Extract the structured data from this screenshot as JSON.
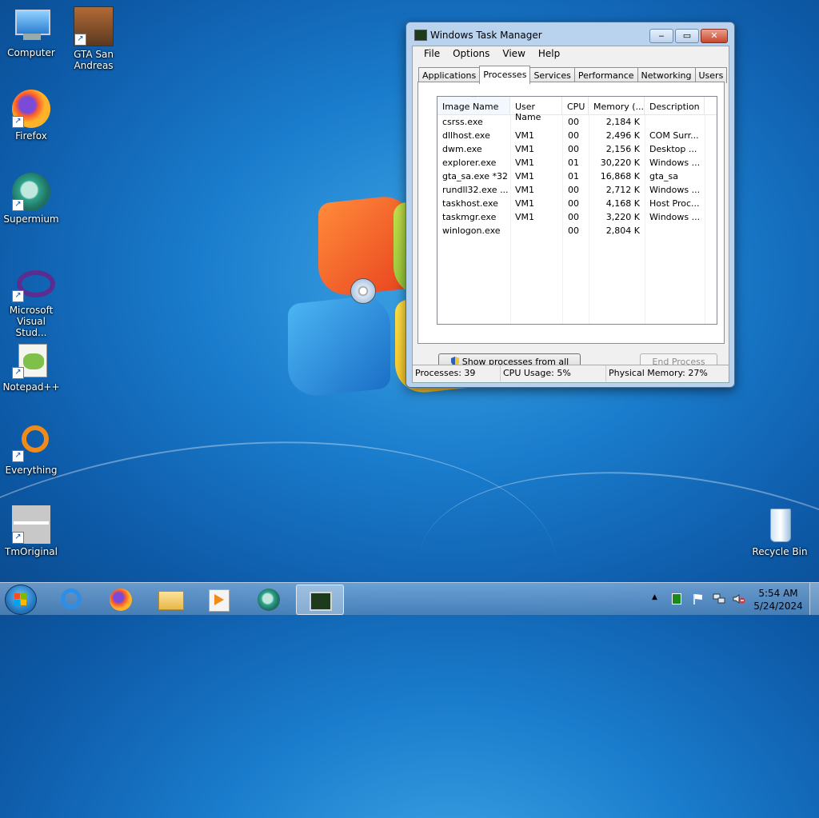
{
  "desktop": {
    "icons": [
      {
        "label_line1": "Computer",
        "label_line2": "",
        "icon": "computer-icon"
      },
      {
        "label_line1": "GTA San",
        "label_line2": "Andreas",
        "icon": "gta-icon"
      },
      {
        "label_line1": "Firefox",
        "label_line2": "",
        "icon": "firefox-icon"
      },
      {
        "label_line1": "Supermium",
        "label_line2": "",
        "icon": "supermium-icon"
      },
      {
        "label_line1": "Microsoft",
        "label_line2": "Visual Stud...",
        "icon": "visual-studio-icon"
      },
      {
        "label_line1": "Notepad++",
        "label_line2": "",
        "icon": "notepadpp-icon"
      },
      {
        "label_line1": "Everything",
        "label_line2": "",
        "icon": "everything-icon"
      },
      {
        "label_line1": "TmOriginal",
        "label_line2": "",
        "icon": "tmoriginal-icon"
      },
      {
        "label_line1": "Recycle Bin",
        "label_line2": "",
        "icon": "recycle-bin-icon"
      }
    ]
  },
  "task_manager": {
    "title": "Windows Task Manager",
    "caption_buttons": {
      "min": "‒",
      "max": "▭",
      "close": "✕"
    },
    "menu": [
      "File",
      "Options",
      "View",
      "Help"
    ],
    "tabs": [
      "Applications",
      "Processes",
      "Services",
      "Performance",
      "Networking",
      "Users"
    ],
    "active_tab": "Processes",
    "columns": [
      "Image Name",
      "User Name",
      "CPU",
      "Memory (...",
      "Description"
    ],
    "rows": [
      {
        "image": "csrss.exe",
        "user": "",
        "cpu": "00",
        "memory": "2,184 K",
        "desc": ""
      },
      {
        "image": "dllhost.exe",
        "user": "VM1",
        "cpu": "00",
        "memory": "2,496 K",
        "desc": "COM Surr..."
      },
      {
        "image": "dwm.exe",
        "user": "VM1",
        "cpu": "00",
        "memory": "2,156 K",
        "desc": "Desktop ..."
      },
      {
        "image": "explorer.exe",
        "user": "VM1",
        "cpu": "01",
        "memory": "30,220 K",
        "desc": "Windows ..."
      },
      {
        "image": "gta_sa.exe *32",
        "user": "VM1",
        "cpu": "01",
        "memory": "16,868 K",
        "desc": "gta_sa"
      },
      {
        "image": "rundll32.exe ...",
        "user": "VM1",
        "cpu": "00",
        "memory": "2,712 K",
        "desc": "Windows ..."
      },
      {
        "image": "taskhost.exe",
        "user": "VM1",
        "cpu": "00",
        "memory": "4,168 K",
        "desc": "Host Proc..."
      },
      {
        "image": "taskmgr.exe",
        "user": "VM1",
        "cpu": "00",
        "memory": "3,220 K",
        "desc": "Windows ..."
      },
      {
        "image": "winlogon.exe",
        "user": "",
        "cpu": "00",
        "memory": "2,804 K",
        "desc": ""
      }
    ],
    "show_all_button": "Show processes from all users",
    "end_process_button": "End Process",
    "status": {
      "processes": "Processes: 39",
      "cpu": "CPU Usage: 5%",
      "memory": "Physical Memory: 27%"
    }
  },
  "taskbar": {
    "pinned": [
      "internet-explorer-icon",
      "firefox-icon",
      "explorer-icon",
      "media-player-icon",
      "supermium-icon",
      "task-manager-icon"
    ],
    "tray_arrow": "▲",
    "clock_time": "5:54 AM",
    "clock_date": "5/24/2024"
  },
  "colors": {
    "accent": "#1a7ccc",
    "taskbar": "#5a8cbe"
  }
}
